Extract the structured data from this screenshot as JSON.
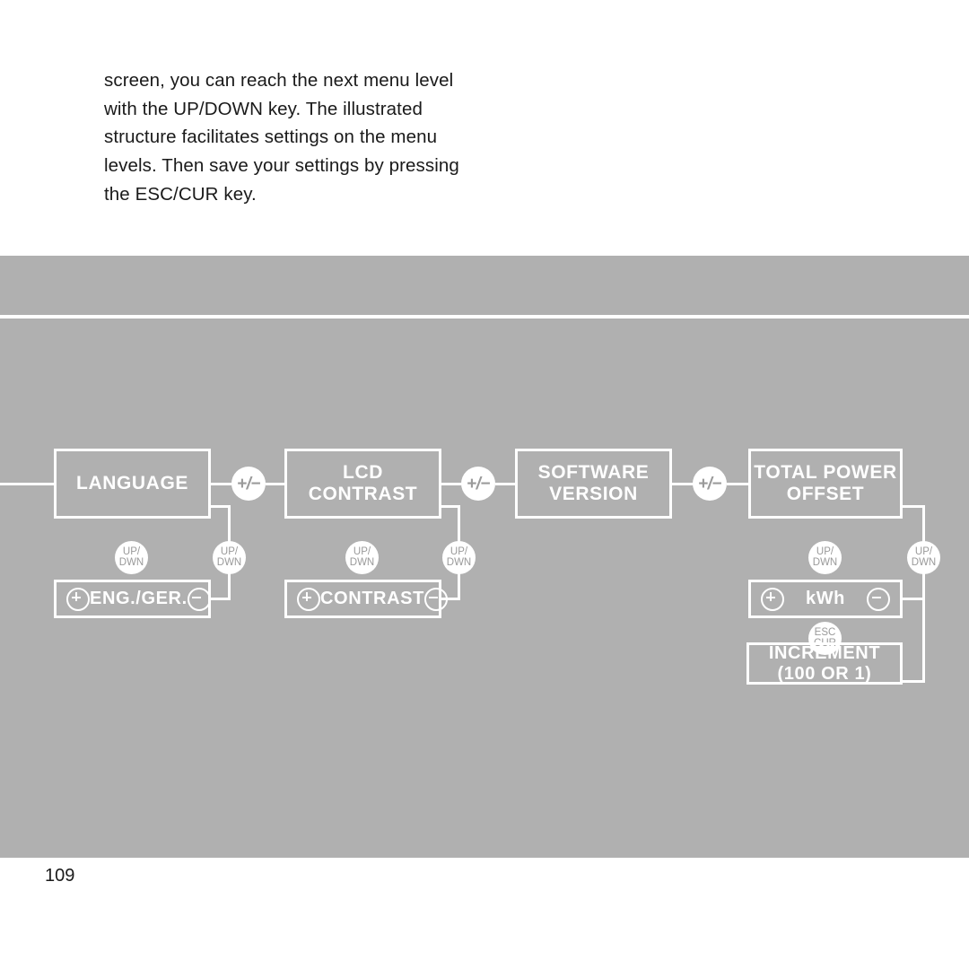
{
  "intro": {
    "paragraph": "screen, you can reach the next menu level with the UP/DOWN key. The illustrated structure facilitates settings on the menu levels. Then save your settings by pressing the ESC/CUR key."
  },
  "page": {
    "number": "109"
  },
  "colors": {
    "band_background": "#b0b0b0",
    "stroke": "#ffffff",
    "badge_text": "#9a9a9a",
    "body_text": "#1a1a1a"
  },
  "diagram": {
    "type": "menu-flow",
    "columns": [
      {
        "id": "language",
        "main": "LANGUAGE",
        "sub": {
          "label": "ENG./GER.",
          "left_icon": "plus-circle-icon",
          "right_icon": "minus-circle-icon"
        },
        "transition_to_sub": "UP/\nDWN",
        "transition_return": "UP/\nDWN",
        "transition_next": "+/−"
      },
      {
        "id": "lcd-contrast",
        "main": "LCD CONTRAST",
        "sub": {
          "label": "CONTRAST",
          "left_icon": "plus-circle-icon",
          "right_icon": "minus-circle-icon"
        },
        "transition_to_sub": "UP/\nDWN",
        "transition_return": "UP/\nDWN",
        "transition_next": "+/−"
      },
      {
        "id": "software-version",
        "main": "SOFTWARE\nVERSION",
        "sub": null,
        "transition_next": "+/−"
      },
      {
        "id": "total-power-offset",
        "main": "TOTAL POWER\nOFFSET",
        "sub": {
          "label": "kWh",
          "left_icon": "plus-circle-icon",
          "right_icon": "minus-circle-icon"
        },
        "sub2": "INCREMENT\n(100 OR 1)",
        "transition_to_sub": "UP/\nDWN",
        "transition_return": "UP/\nDWN",
        "transition_to_sub2": "ESC\nCUR"
      }
    ],
    "badges": {
      "plus_minus": "+/−",
      "updown_line1": "UP/",
      "updown_line2": "DWN",
      "esccur_line1": "ESC",
      "esccur_line2": "CUR"
    }
  }
}
